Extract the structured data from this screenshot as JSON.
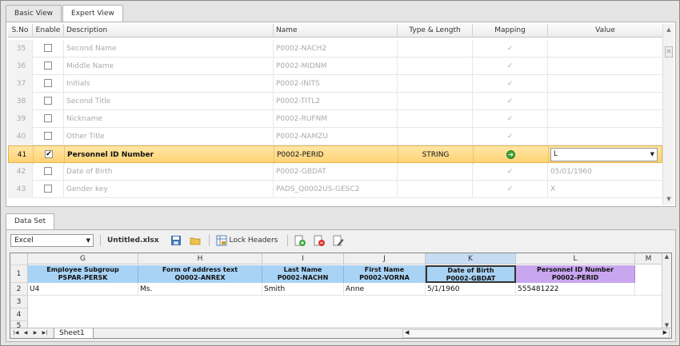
{
  "tabs": [
    "Basic View",
    "Expert View"
  ],
  "grid": {
    "headers": [
      "S.No",
      "Enable",
      "Description",
      "Name",
      "Type & Length",
      "Mapping",
      "Value"
    ],
    "rows": [
      {
        "sno": "35",
        "enabled": false,
        "desc": "Second Name",
        "name": "P0002-NACH2",
        "type": "",
        "mapping": "tick",
        "value": ""
      },
      {
        "sno": "36",
        "enabled": false,
        "desc": "Middle Name",
        "name": "P0002-MIDNM",
        "type": "",
        "mapping": "tick",
        "value": ""
      },
      {
        "sno": "37",
        "enabled": false,
        "desc": "Initials",
        "name": "P0002-INITS",
        "type": "",
        "mapping": "tick",
        "value": ""
      },
      {
        "sno": "38",
        "enabled": false,
        "desc": "Second Title",
        "name": "P0002-TITL2",
        "type": "",
        "mapping": "tick",
        "value": ""
      },
      {
        "sno": "39",
        "enabled": false,
        "desc": "Nickname",
        "name": "P0002-RUFNM",
        "type": "",
        "mapping": "tick",
        "value": ""
      },
      {
        "sno": "40",
        "enabled": false,
        "desc": "Other Title",
        "name": "P0002-NAMZU",
        "type": "",
        "mapping": "tick",
        "value": ""
      },
      {
        "sno": "41",
        "enabled": true,
        "desc": "Personnel ID Number",
        "name": "P0002-PERID",
        "type": "STRING",
        "mapping": "green",
        "value": "L"
      },
      {
        "sno": "42",
        "enabled": false,
        "desc": "Date of Birth",
        "name": "P0002-GBDAT",
        "type": "",
        "mapping": "tick",
        "value": "05/01/1960"
      },
      {
        "sno": "43",
        "enabled": false,
        "desc": "Gender key",
        "name": "PADS_Q0002US-GESC2",
        "type": "",
        "mapping": "tick",
        "value": "X"
      }
    ]
  },
  "dataset_tab": "Data Set",
  "toolbar": {
    "format": "Excel",
    "filename": "Untitled.xlsx",
    "lock_headers": "Lock Headers"
  },
  "sheet": {
    "columns": [
      "G",
      "H",
      "I",
      "J",
      "K",
      "L",
      "M"
    ],
    "row_numbers": [
      "1",
      "2",
      "3",
      "4",
      "5"
    ],
    "header_cells": [
      {
        "line1": "Employee Subgroup",
        "line2": "PSPAR-PERSK"
      },
      {
        "line1": "Form of address text",
        "line2": "Q0002-ANREX"
      },
      {
        "line1": "Last Name",
        "line2": "P0002-NACHN"
      },
      {
        "line1": "First Name",
        "line2": "P0002-VORNA"
      },
      {
        "line1": "Date of Birth",
        "line2": "P0002-GBDAT"
      },
      {
        "line1": "Personnel ID Number",
        "line2": "P0002-PERID"
      }
    ],
    "row2": [
      "U4",
      "Ms.",
      "Smith",
      "Anne",
      "5/1/1960",
      "555481222"
    ],
    "sheet_tab": "Sheet1"
  }
}
